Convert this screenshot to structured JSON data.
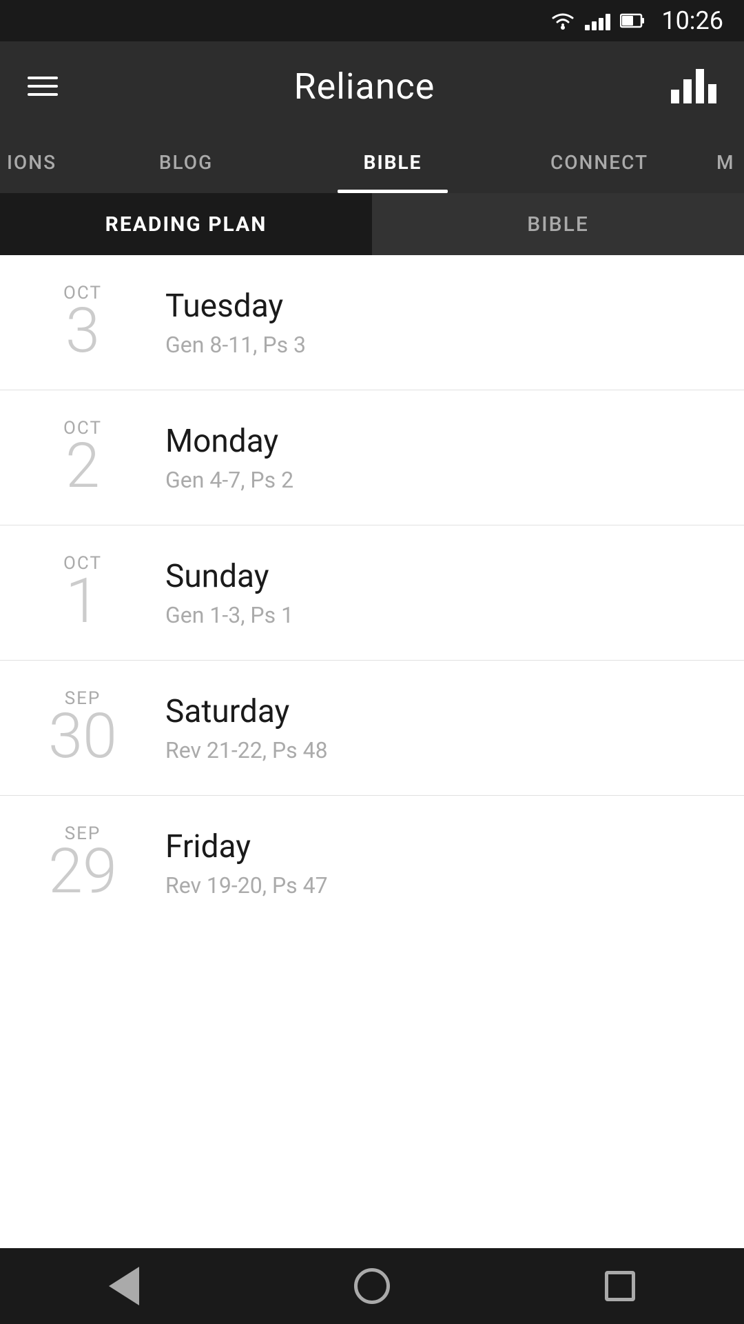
{
  "statusBar": {
    "time": "10:26"
  },
  "appBar": {
    "title": "Reliance"
  },
  "navTabs": {
    "items": [
      {
        "id": "devotions",
        "label": "IONS",
        "partialLeft": true,
        "active": false
      },
      {
        "id": "blog",
        "label": "BLOG",
        "active": false
      },
      {
        "id": "bible",
        "label": "BIBLE",
        "active": true
      },
      {
        "id": "connect",
        "label": "CONNECT",
        "active": false
      },
      {
        "id": "more",
        "label": "M",
        "partialRight": true,
        "active": false
      }
    ]
  },
  "subTabs": {
    "items": [
      {
        "id": "reading-plan",
        "label": "READING PLAN",
        "active": true
      },
      {
        "id": "bible",
        "label": "BIBLE",
        "active": false
      }
    ]
  },
  "readingItems": [
    {
      "month": "OCT",
      "day": "3",
      "dayName": "Tuesday",
      "readings": "Gen 8-11, Ps 3"
    },
    {
      "month": "OCT",
      "day": "2",
      "dayName": "Monday",
      "readings": "Gen 4-7, Ps 2"
    },
    {
      "month": "OCT",
      "day": "1",
      "dayName": "Sunday",
      "readings": "Gen 1-3, Ps 1"
    },
    {
      "month": "SEP",
      "day": "30",
      "dayName": "Saturday",
      "readings": "Rev 21-22, Ps 48"
    },
    {
      "month": "SEP",
      "day": "29",
      "dayName": "Friday",
      "readings": "Rev 19-20, Ps 47"
    }
  ],
  "bottomNav": {
    "back_label": "back",
    "home_label": "home",
    "recent_label": "recent"
  }
}
